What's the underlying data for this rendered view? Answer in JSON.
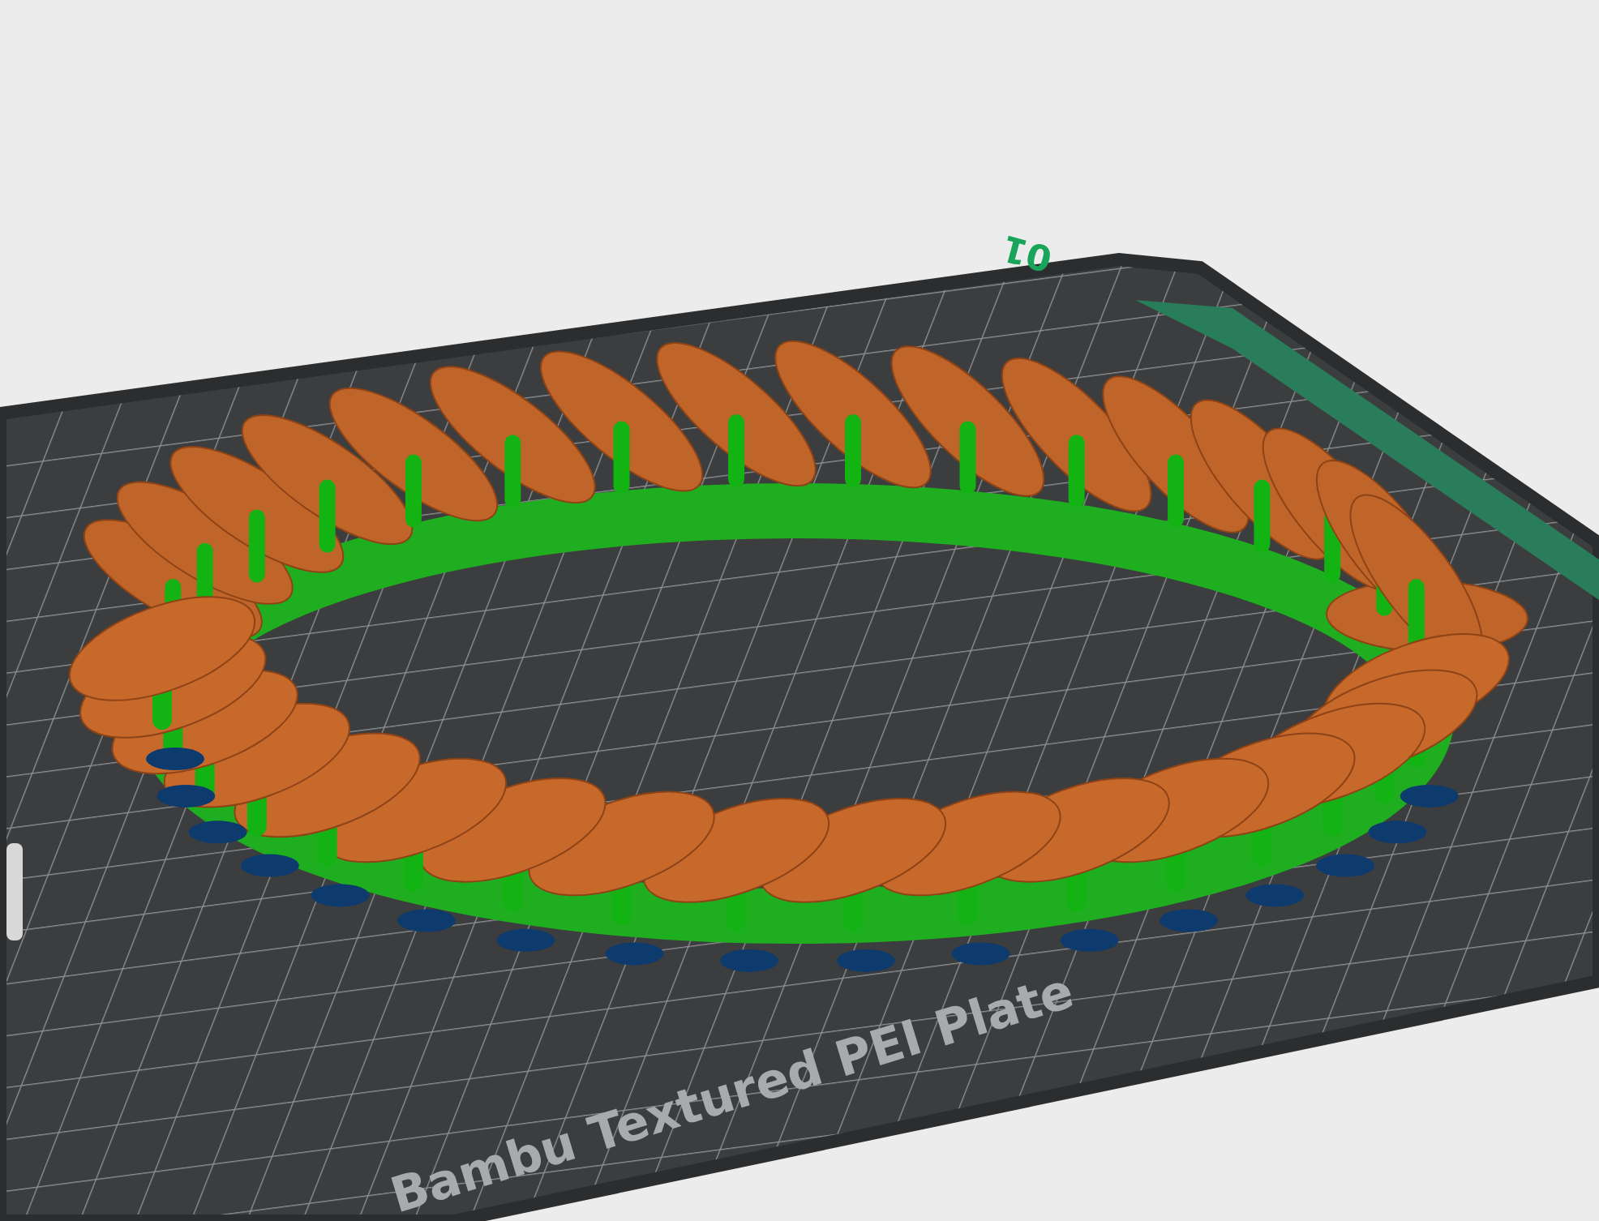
{
  "viewport": {
    "plate_number": "01",
    "plate_label": "Bambu Textured PEI Plate"
  }
}
